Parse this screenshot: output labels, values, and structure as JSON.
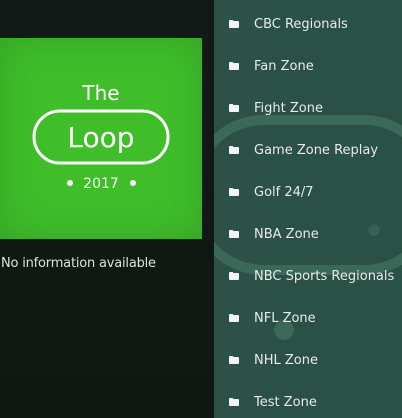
{
  "thumbnail": {
    "logo_word_top": "The",
    "logo_word_main": "Loop",
    "logo_year": "2017",
    "background_color": "#3fbe2a"
  },
  "info": {
    "text": "No information available"
  },
  "menu": {
    "folder_icon": "folder-icon",
    "items": [
      {
        "label": "CBC Regionals"
      },
      {
        "label": "Fan Zone"
      },
      {
        "label": "Fight Zone"
      },
      {
        "label": "Game Zone Replay"
      },
      {
        "label": "Golf 24/7"
      },
      {
        "label": "NBA Zone"
      },
      {
        "label": "NBC Sports Regionals"
      },
      {
        "label": "NFL Zone"
      },
      {
        "label": "NHL Zone"
      },
      {
        "label": "Test Zone"
      }
    ]
  },
  "colors": {
    "left_background": "#121a17",
    "right_background": "#2a4f44",
    "text": "#e6ece9"
  }
}
